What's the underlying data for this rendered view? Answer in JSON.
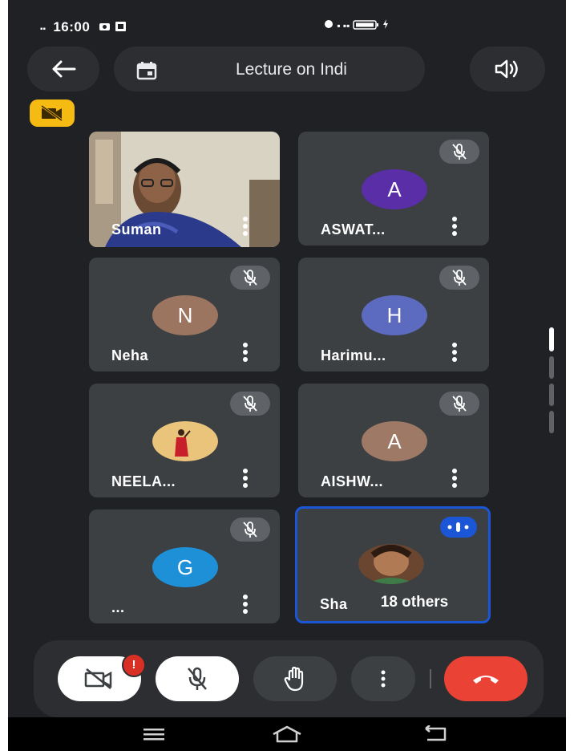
{
  "status_bar": {
    "time": "16:00",
    "left_signal": "▪▪",
    "right_text": "▪ ▪▪"
  },
  "top_bar": {
    "meeting_title": "Lecture on Indi"
  },
  "participants": [
    {
      "name": "Suman",
      "avatar_letter": "",
      "avatar_color": "#000000",
      "type": "video",
      "muted": false
    },
    {
      "name": "ASWAT...",
      "avatar_letter": "A",
      "avatar_color": "#5a2ea6",
      "type": "letter",
      "muted": true
    },
    {
      "name": "Neha",
      "avatar_letter": "N",
      "avatar_color": "#9c7560",
      "type": "letter",
      "muted": true
    },
    {
      "name": "Harimu...",
      "avatar_letter": "H",
      "avatar_color": "#5c6bc0",
      "type": "letter",
      "muted": true
    },
    {
      "name": "NEELA...",
      "avatar_letter": "",
      "avatar_color": "#e4b86a",
      "type": "photo",
      "muted": true
    },
    {
      "name": "AISHW...",
      "avatar_letter": "A",
      "avatar_color": "#9e7a66",
      "type": "letter",
      "muted": true
    },
    {
      "name": "...",
      "avatar_letter": "G",
      "avatar_color": "#1e90d8",
      "type": "letter",
      "muted": true
    },
    {
      "name": "Shah",
      "avatar_letter": "",
      "avatar_color": "#8a5a3a",
      "type": "photo",
      "muted": false,
      "speaking": true
    }
  ],
  "others_count_label": "18 others",
  "controls": {
    "camera_alert": "!"
  },
  "colors": {
    "background": "#202124",
    "tile": "#3c4043",
    "surface": "#2d2e31",
    "camera_badge": "#f6bb12",
    "end_call": "#ea4335",
    "active_border": "#1a56d6"
  }
}
